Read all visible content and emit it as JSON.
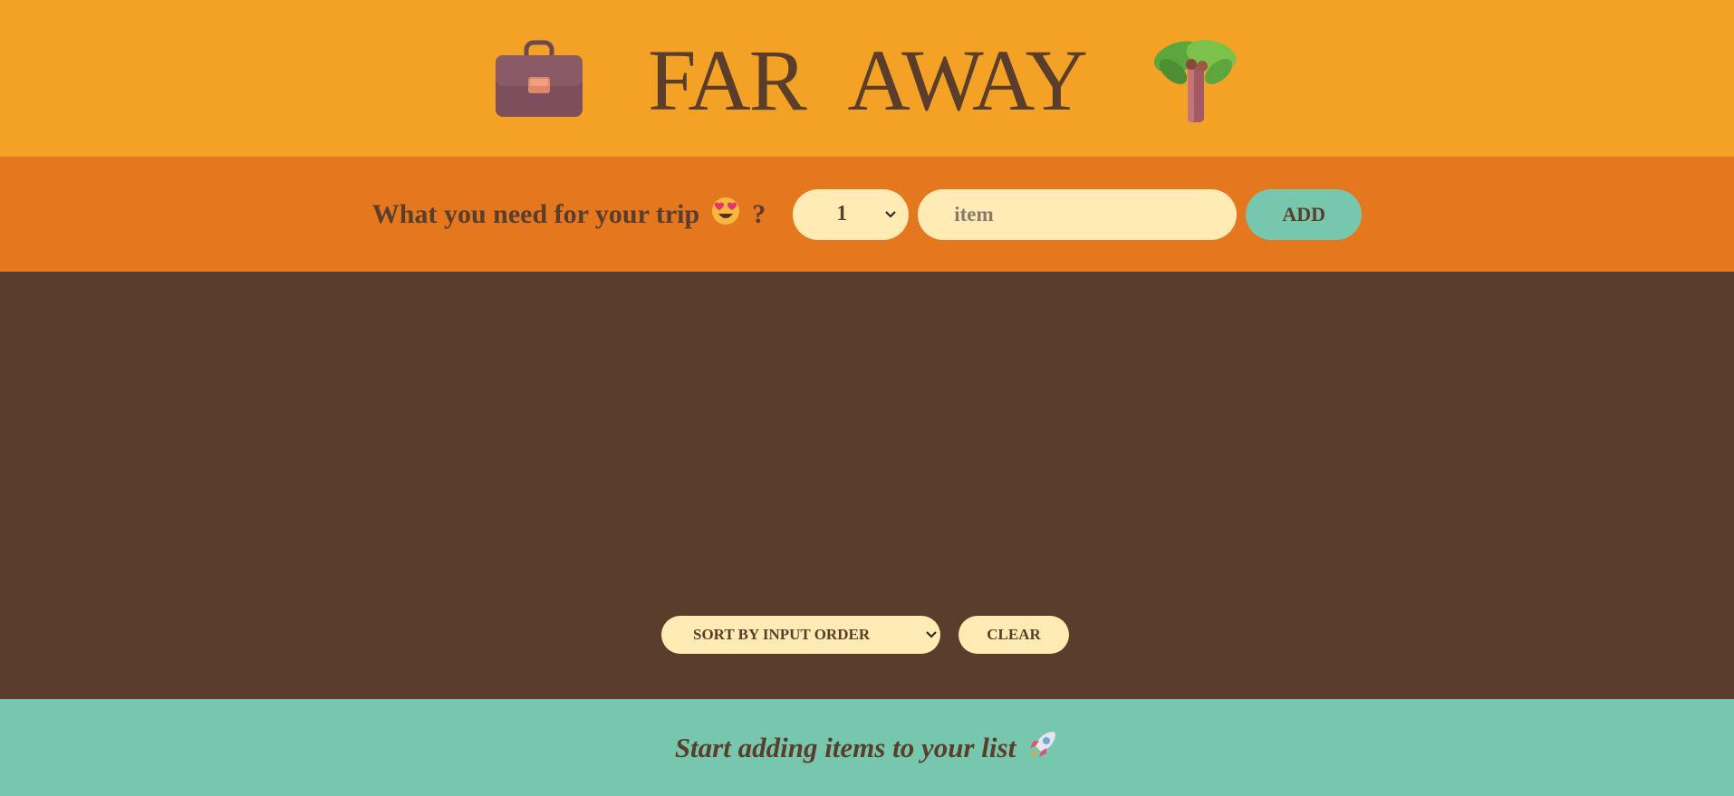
{
  "header": {
    "title": "FAR AWAY",
    "left_icon": "briefcase-icon",
    "right_icon": "palm-tree-icon"
  },
  "form": {
    "question": "What you need for your trip",
    "question_suffix": "?",
    "question_emoji": "heart-eyes-face-icon",
    "quantity_value": "1",
    "item_placeholder": "item",
    "add_label": "ADD"
  },
  "actions": {
    "sort_value": "SORT BY INPUT ORDER",
    "clear_label": "CLEAR"
  },
  "stats": {
    "message": "Start adding items to your list",
    "emoji": "rocket-icon"
  },
  "colors": {
    "header_bg": "#f4a226",
    "form_bg": "#e5771f",
    "list_bg": "#5a3e2b",
    "stats_bg": "#76c7ad",
    "field_bg": "#ffebb3",
    "text": "#5a3e2b"
  }
}
